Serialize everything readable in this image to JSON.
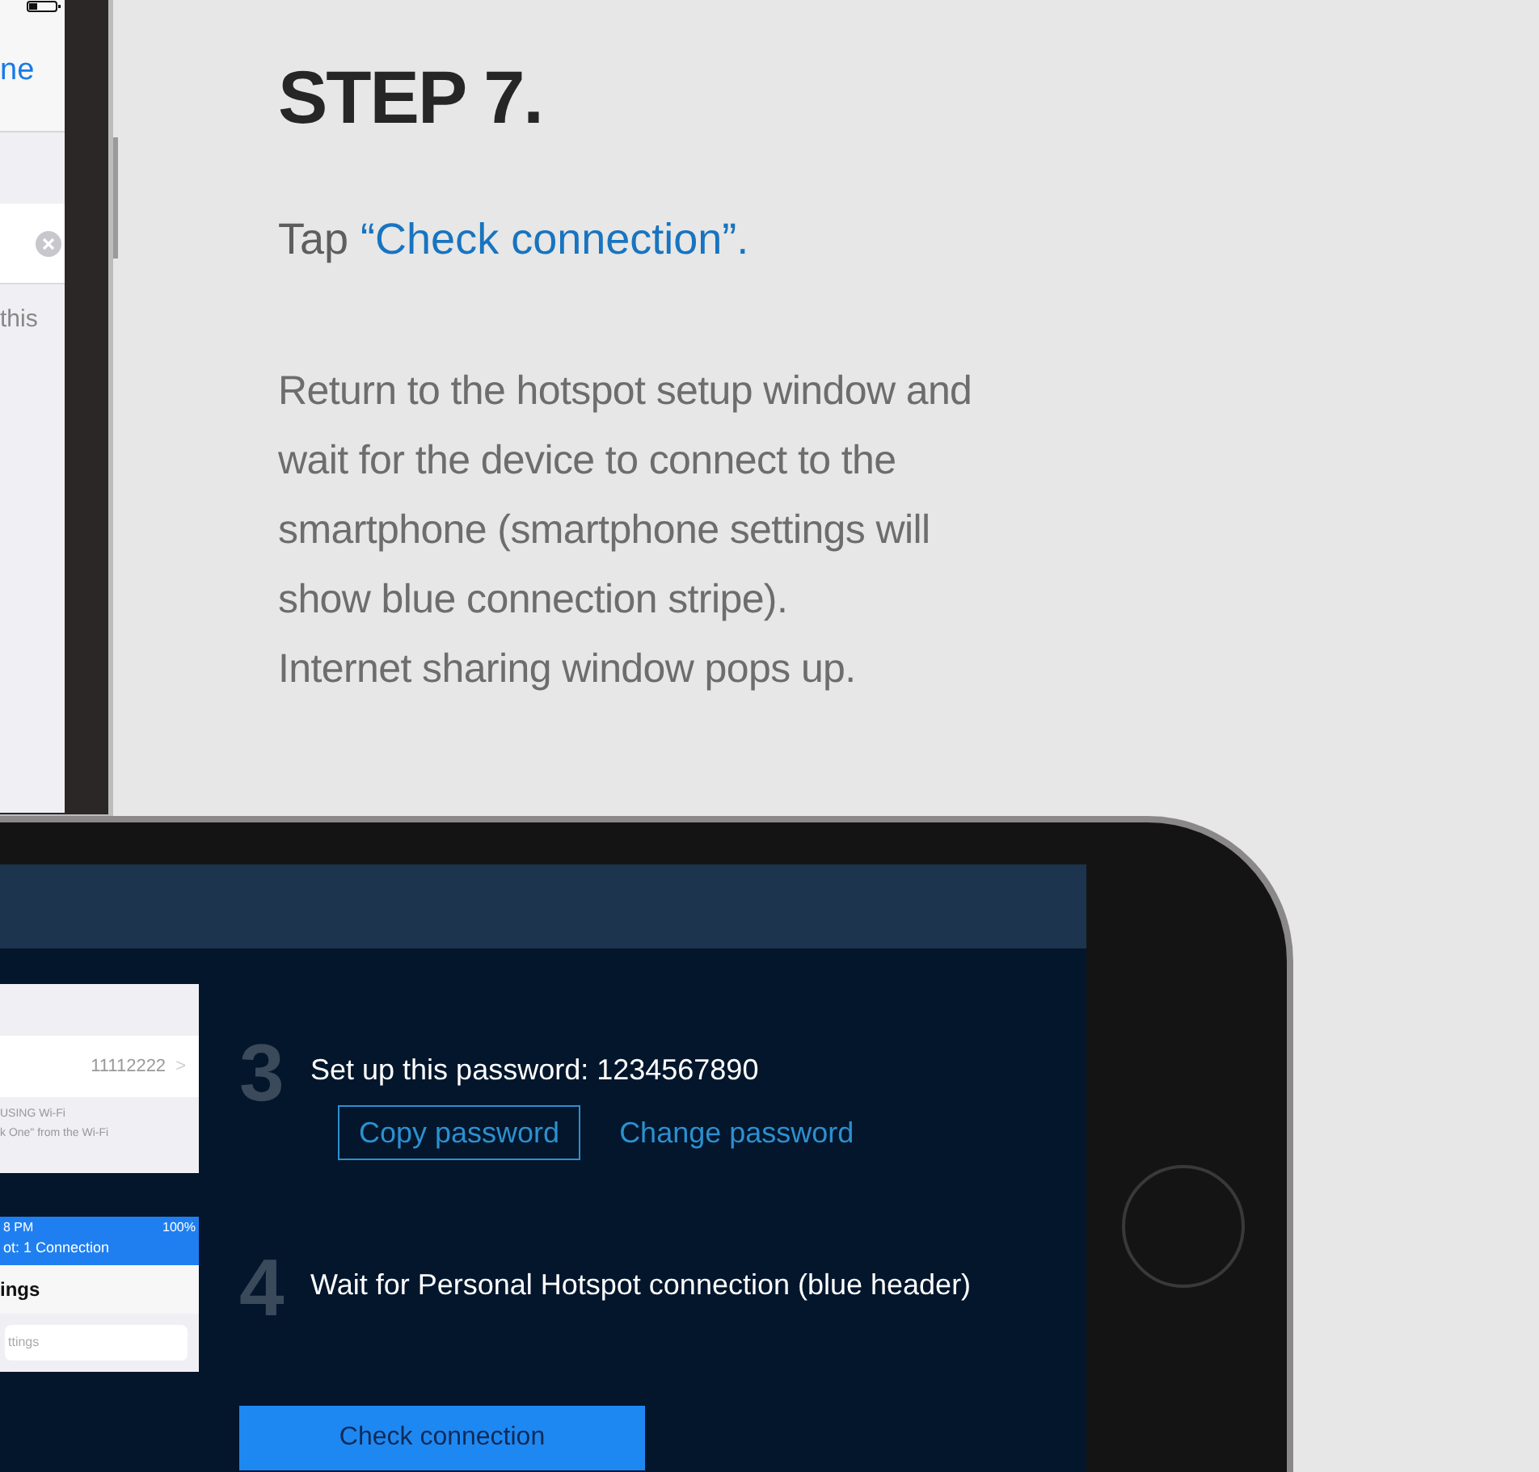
{
  "portrait_phone": {
    "nav_button": "ne",
    "note": "this"
  },
  "step": {
    "title": "STEP 7.",
    "instruction": "Tap ",
    "instruction_target": "“Check connection”.",
    "description": [
      "Return to the hotspot setup window and",
      "wait for the device to connect to the",
      "smartphone (smartphone settings will",
      "show blue connection stripe).",
      "Internet sharing window pops up."
    ]
  },
  "landscape_phone": {
    "inset_password": {
      "value": "11112222",
      "chevron": ">",
      "footnote_1": "USING Wi-Fi",
      "footnote_2": "k One\" from the Wi-Fi"
    },
    "inset_settings": {
      "time": "8 PM",
      "battery": "100%",
      "banner": "ot: 1 Connection",
      "title": "ings",
      "search_placeholder": "ttings"
    },
    "steps": [
      {
        "number": "3",
        "text": "Set up this password: 1234567890",
        "actions": [
          {
            "kind": "outlined",
            "label": "Copy password"
          },
          {
            "kind": "link",
            "label": "Change password"
          }
        ]
      },
      {
        "number": "4",
        "text": "Wait for Personal Hotspot connection (blue header)"
      }
    ],
    "primary_button": "Check connection"
  }
}
